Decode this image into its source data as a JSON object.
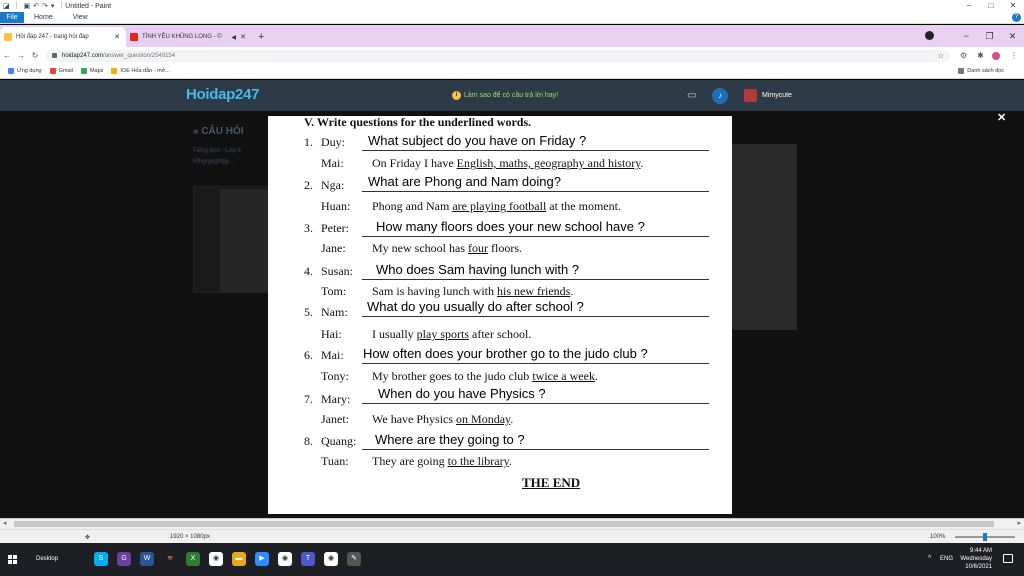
{
  "paint": {
    "title": "Untitled - Paint",
    "ribbon": [
      "File",
      "Home",
      "View"
    ],
    "status": {
      "dimensions": "1920 × 1080px",
      "zoom": "100%"
    }
  },
  "browser": {
    "tabs": [
      {
        "label": "Hỏi đáp 247 - trang hỏi đáp",
        "active": true
      },
      {
        "label": "TÌNH YÊU KHỦNG LONG - ©",
        "active": false
      }
    ],
    "new_tab": "+",
    "url_host": "hoidap247.com",
    "url_path": "/answer_question/2549154",
    "bookmarks": [
      "Ứng dụng",
      "Gmail",
      "Maps",
      "IOE Hỏa dẫn - mở..."
    ],
    "bookmarks_right": "Danh sách đọc"
  },
  "site": {
    "logo": "Hoidap247",
    "promo": "Làm sao để có câu trả lời hay!",
    "username": "Mimycute",
    "bg_back": "« CÂU HỎI",
    "bg_subject": "Tiếng Anh · Lớp 6",
    "bg_user": "Hfhgrgeghtgy..."
  },
  "worksheet": {
    "title": "V. Write questions for the underlined words.",
    "items": [
      {
        "num": "1.",
        "asker": "Duy:",
        "question": "What subject do you have on Friday ?",
        "responder": "Mai:",
        "response_pre": "On Friday I have ",
        "response_underlined": "English, maths, geography and history",
        "response_post": "."
      },
      {
        "num": "2.",
        "asker": "Nga:",
        "question": "What are Phong and Nam doing?",
        "responder": "Huan:",
        "response_pre": "Phong and Nam ",
        "response_underlined": "are playing football",
        "response_post": " at the moment."
      },
      {
        "num": "3.",
        "asker": "Peter:",
        "question": "How many floors does your new school have ?",
        "responder": "Jane:",
        "response_pre": "My new school has ",
        "response_underlined": "four",
        "response_post": " floors."
      },
      {
        "num": "4.",
        "asker": "Susan:",
        "question": "Who does Sam having lunch with ?",
        "responder": "Tom:",
        "response_pre": "Sam is having lunch with ",
        "response_underlined": "his new friends",
        "response_post": "."
      },
      {
        "num": "5.",
        "asker": "Nam:",
        "question": "What do you usually do after school ?",
        "responder": "Hai:",
        "response_pre": "I usually ",
        "response_underlined": "play sports",
        "response_post": " after school."
      },
      {
        "num": "6.",
        "asker": "Mai:",
        "question": "How often does your brother go to the judo club ?",
        "responder": "Tony:",
        "response_pre": "My brother goes to the judo club ",
        "response_underlined": "twice a week",
        "response_post": "."
      },
      {
        "num": "7.",
        "asker": "Mary:",
        "question": "When do you have Physics ?",
        "responder": "Janet:",
        "response_pre": "We have Physics ",
        "response_underlined": "on Monday",
        "response_post": "."
      },
      {
        "num": "8.",
        "asker": "Quang:",
        "question": "Where are they going to ?",
        "responder": "Tuan:",
        "response_pre": "They are going ",
        "response_underlined": "to the library",
        "response_post": "."
      }
    ],
    "the_end": "THE END"
  },
  "taskbar": {
    "desktop": "Desktop",
    "time": "9:44 AM",
    "day": "Wednesday",
    "date": "10/6/2021",
    "lang": "ENG"
  }
}
